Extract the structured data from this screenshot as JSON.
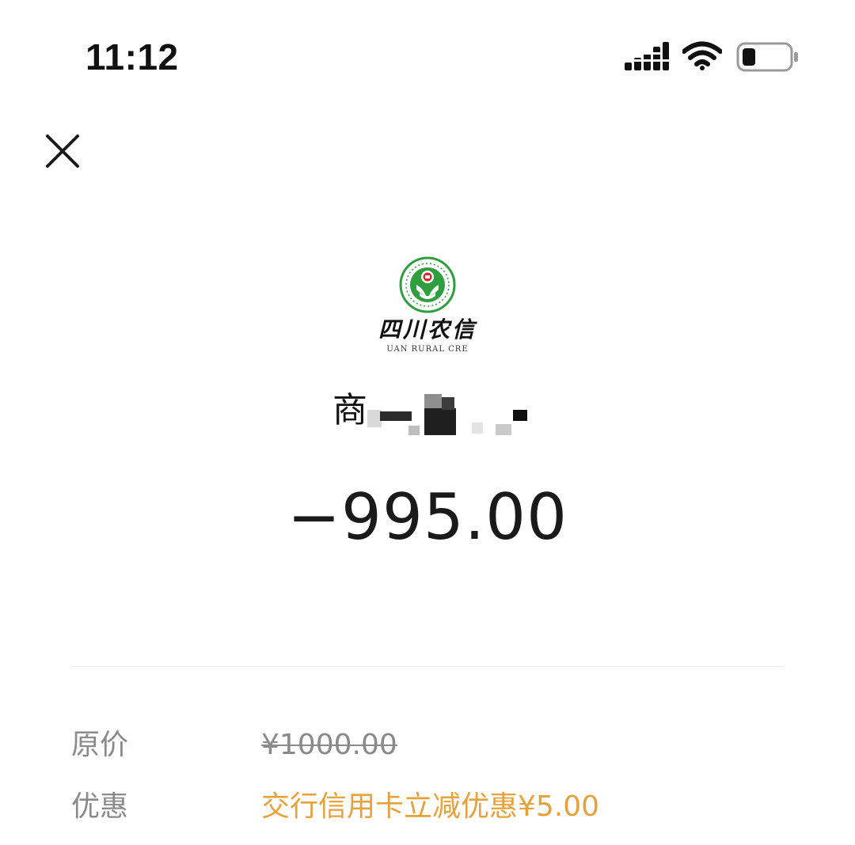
{
  "status_bar": {
    "time": "11:12",
    "icons": [
      "cellular-signal-icon",
      "wifi-icon",
      "battery-icon"
    ]
  },
  "header": {
    "close_icon": "close-icon"
  },
  "logo": {
    "name_cn": "四川农信",
    "name_en": "UAN RURAL CRE",
    "emblem_color": "#2e9e3f",
    "accent_color": "#d62b2b"
  },
  "merchant": {
    "name_visible_prefix": "商"
  },
  "transaction": {
    "amount": "−995.00"
  },
  "details": {
    "original_price": {
      "label": "原价",
      "value": "¥1000.00"
    },
    "discount": {
      "label": "优惠",
      "value": "交行信用卡立减优惠¥5.00"
    }
  },
  "colors": {
    "text_primary": "#1a1a1a",
    "text_secondary": "#8a8a8a",
    "discount_accent": "#e6a23c",
    "divider": "#e8e8e8"
  }
}
